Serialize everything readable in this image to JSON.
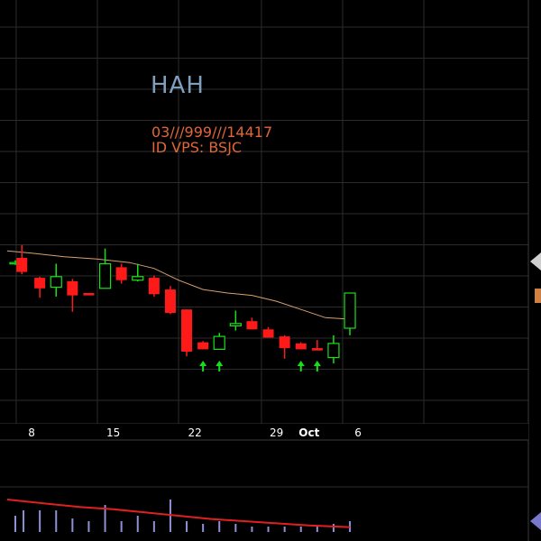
{
  "header": {
    "ticker": "HAH",
    "code": "03///999///14417",
    "id_line": "ID VPS: BSJC"
  },
  "colors": {
    "up": "#18e018",
    "down": "#ff1a1a",
    "ma": "#d8a070",
    "grid": "#2c2c2c",
    "volume": "#9090d8",
    "volume_line": "#e02020",
    "axis_text": "#ffffff",
    "marker": "#d08040"
  },
  "chart_data": [
    {
      "type": "candlestick",
      "x_tick_labels": [
        {
          "label": "8",
          "day": 1,
          "bold": false
        },
        {
          "label": "15",
          "day": 6,
          "bold": false
        },
        {
          "label": "22",
          "day": 11,
          "bold": false
        },
        {
          "label": "29",
          "day": 16,
          "bold": false
        },
        {
          "label": "Oct",
          "day": 18,
          "bold": true
        },
        {
          "label": "6",
          "day": 21,
          "bold": false
        }
      ],
      "y_range": [
        0,
        100
      ],
      "candles": [
        {
          "day": 0,
          "open": 69,
          "close": 70,
          "high": 72,
          "low": 68
        },
        {
          "day": 0.4,
          "open": 74,
          "close": 62,
          "high": 85,
          "low": 60
        },
        {
          "day": 1.5,
          "open": 57,
          "close": 48,
          "high": 58,
          "low": 40
        },
        {
          "day": 2.5,
          "open": 49,
          "close": 58,
          "high": 69,
          "low": 41
        },
        {
          "day": 3.5,
          "open": 54,
          "close": 42,
          "high": 56,
          "low": 28
        },
        {
          "day": 4.5,
          "open": 44,
          "close": 42,
          "high": 44,
          "low": 42
        },
        {
          "day": 5.5,
          "open": 48,
          "close": 69,
          "high": 82,
          "low": 48
        },
        {
          "day": 6.5,
          "open": 66,
          "close": 55,
          "high": 69,
          "low": 52
        },
        {
          "day": 7.5,
          "open": 55,
          "close": 58,
          "high": 69,
          "low": 54
        },
        {
          "day": 8.5,
          "open": 57,
          "close": 43,
          "high": 59,
          "low": 41
        },
        {
          "day": 9.5,
          "open": 47,
          "close": 27,
          "high": 50,
          "low": 26
        },
        {
          "day": 10.5,
          "open": 30,
          "close": -6,
          "high": 30,
          "low": -10
        },
        {
          "day": 11.5,
          "open": 2,
          "close": -4,
          "high": 3,
          "low": -4
        },
        {
          "day": 12.5,
          "open": -4,
          "close": 7,
          "high": 10,
          "low": -4
        },
        {
          "day": 13.5,
          "open": 16,
          "close": 18,
          "high": 29,
          "low": 12
        },
        {
          "day": 14.5,
          "open": 20,
          "close": 13,
          "high": 23,
          "low": 13
        },
        {
          "day": 15.5,
          "open": 13,
          "close": 6,
          "high": 15,
          "low": 6
        },
        {
          "day": 16.5,
          "open": 7,
          "close": -3,
          "high": 8,
          "low": -12
        },
        {
          "day": 17.5,
          "open": 1,
          "close": -4,
          "high": 2,
          "low": -4
        },
        {
          "day": 18.5,
          "open": -3,
          "close": -5,
          "high": 4,
          "low": -5
        },
        {
          "day": 19.5,
          "open": -11,
          "close": 1,
          "high": 8,
          "low": -16
        },
        {
          "day": 20.5,
          "open": 14,
          "close": 44,
          "high": 44,
          "low": 8
        }
      ],
      "moving_average": [
        {
          "day": -0.5,
          "value": 80
        },
        {
          "day": 1,
          "value": 78
        },
        {
          "day": 3,
          "value": 75
        },
        {
          "day": 5,
          "value": 73
        },
        {
          "day": 7,
          "value": 70
        },
        {
          "day": 8.5,
          "value": 65
        },
        {
          "day": 10,
          "value": 55
        },
        {
          "day": 11.5,
          "value": 47
        },
        {
          "day": 13,
          "value": 44
        },
        {
          "day": 14.5,
          "value": 42
        },
        {
          "day": 16,
          "value": 37
        },
        {
          "day": 17.5,
          "value": 30
        },
        {
          "day": 19,
          "value": 23
        },
        {
          "day": 20.2,
          "value": 22
        }
      ],
      "signal_arrows": [
        11.5,
        12.5,
        17.5,
        18.5
      ]
    },
    {
      "type": "bar",
      "y_range": [
        0,
        10
      ],
      "volume": [
        {
          "day": 0,
          "value": 3
        },
        {
          "day": 0.5,
          "value": 4
        },
        {
          "day": 1.5,
          "value": 4
        },
        {
          "day": 2.5,
          "value": 4
        },
        {
          "day": 3.5,
          "value": 2.5
        },
        {
          "day": 4.5,
          "value": 2
        },
        {
          "day": 5.5,
          "value": 5
        },
        {
          "day": 6.5,
          "value": 2
        },
        {
          "day": 7.5,
          "value": 3
        },
        {
          "day": 8.5,
          "value": 2
        },
        {
          "day": 9.5,
          "value": 6
        },
        {
          "day": 10.5,
          "value": 2
        },
        {
          "day": 11.5,
          "value": 1.5
        },
        {
          "day": 12.5,
          "value": 2
        },
        {
          "day": 13.5,
          "value": 1.5
        },
        {
          "day": 14.5,
          "value": 1
        },
        {
          "day": 15.5,
          "value": 1
        },
        {
          "day": 16.5,
          "value": 1
        },
        {
          "day": 17.5,
          "value": 1
        },
        {
          "day": 18.5,
          "value": 1
        },
        {
          "day": 19.5,
          "value": 1.5
        },
        {
          "day": 20.5,
          "value": 2
        }
      ],
      "volume_average": [
        {
          "day": -0.5,
          "value": 6
        },
        {
          "day": 2,
          "value": 5.2
        },
        {
          "day": 4,
          "value": 4.6
        },
        {
          "day": 6,
          "value": 4.2
        },
        {
          "day": 8,
          "value": 3.6
        },
        {
          "day": 10,
          "value": 3
        },
        {
          "day": 12,
          "value": 2.4
        },
        {
          "day": 14,
          "value": 2
        },
        {
          "day": 16,
          "value": 1.6
        },
        {
          "day": 18,
          "value": 1.2
        },
        {
          "day": 20.5,
          "value": 0.9
        }
      ]
    }
  ]
}
